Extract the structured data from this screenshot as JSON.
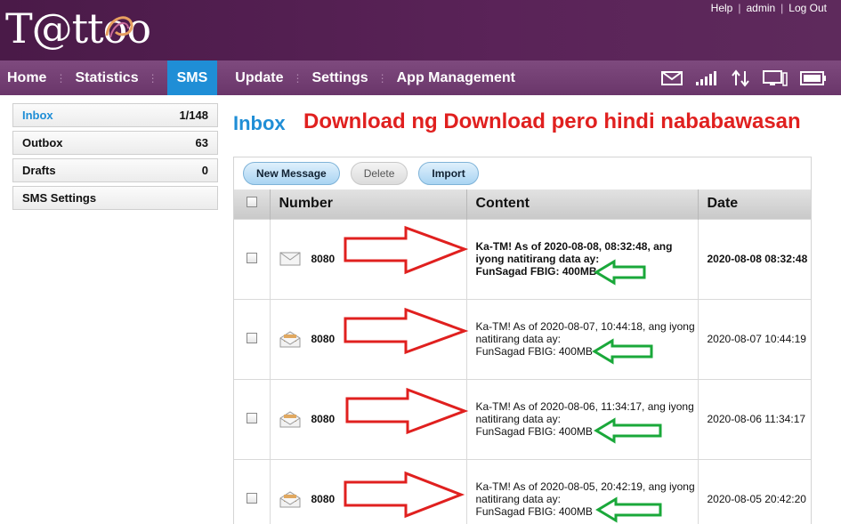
{
  "brand": {
    "logo_text": "T@ttoo"
  },
  "top_links": {
    "help": "Help",
    "admin": "admin",
    "logout": "Log Out"
  },
  "nav": {
    "items": [
      {
        "label": "Home"
      },
      {
        "label": "Statistics"
      },
      {
        "label": "SMS"
      },
      {
        "label": "Update"
      },
      {
        "label": "Settings"
      },
      {
        "label": "App Management"
      }
    ]
  },
  "status_icons": [
    "envelope-icon",
    "signal-icon",
    "data-transfer-icon",
    "pc-icon",
    "battery-icon"
  ],
  "sidebar": {
    "items": [
      {
        "label": "Inbox",
        "count": "1/148"
      },
      {
        "label": "Outbox",
        "count": "63"
      },
      {
        "label": "Drafts",
        "count": "0"
      },
      {
        "label": "SMS Settings",
        "count": ""
      }
    ]
  },
  "main": {
    "title": "Inbox",
    "annotation": "Download ng Download pero hindi nababawasan",
    "toolbar": {
      "new_message": "New Message",
      "delete": "Delete",
      "import": "Import"
    },
    "columns": {
      "number": "Number",
      "content": "Content",
      "date": "Date"
    },
    "messages": [
      {
        "number": "8080",
        "unread": true,
        "line1": "Ka-TM! As of 2020-08-08, 08:32:48, ang",
        "line2": "iyong natitirang data ay:",
        "line3": "FunSagad FBIG: 400MB",
        "date": "2020-08-08 08:32:48"
      },
      {
        "number": "8080",
        "unread": false,
        "line1": "Ka-TM! As of 2020-08-07, 10:44:18, ang iyong",
        "line2": "natitirang data ay:",
        "line3": "FunSagad FBIG: 400MB",
        "date": "2020-08-07 10:44:19"
      },
      {
        "number": "8080",
        "unread": false,
        "line1": "Ka-TM! As of 2020-08-06, 11:34:17, ang iyong",
        "line2": "natitirang data ay:",
        "line3": "FunSagad FBIG: 400MB",
        "date": "2020-08-06 11:34:17"
      },
      {
        "number": "8080",
        "unread": false,
        "line1": "Ka-TM! As of 2020-08-05, 20:42:19, ang iyong",
        "line2": "natitirang data ay:",
        "line3": "FunSagad FBIG: 400MB",
        "date": "2020-08-05 20:42:20"
      }
    ]
  },
  "colors": {
    "accent": "#1f8ed6",
    "annotation_red": "#e0201f",
    "annotation_green": "#1aa83a",
    "header_purple": "#5a2358"
  }
}
